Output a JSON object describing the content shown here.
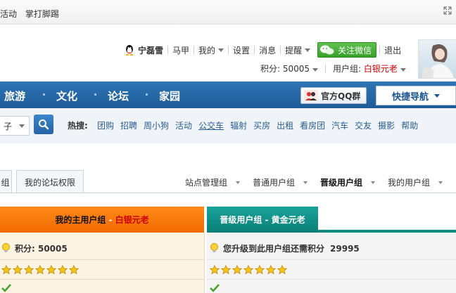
{
  "topbar": {
    "links": [
      "活动",
      "掌打脚踢"
    ]
  },
  "user": {
    "name": "宁磊雪",
    "menu": [
      "马甲",
      "我的",
      "设置",
      "消息",
      "提醒"
    ],
    "wechat_label": "关注微信",
    "logout": "退出",
    "score_label": "积分: 50005",
    "group_prefix": "用户组: ",
    "group_name": "白银元老"
  },
  "nav": {
    "items": [
      "旅游",
      "文化",
      "论坛",
      "家园"
    ],
    "qq_group": "官方QQ群",
    "quick_nav": "快捷导航"
  },
  "search": {
    "select_value": "子",
    "hot_label": "热搜:",
    "hot_links": [
      "团购",
      "招聘",
      "周小狗",
      "活动",
      "公交车",
      "辐射",
      "买房",
      "出租",
      "看房团",
      "汽车",
      "交友",
      "摄影",
      "帮助"
    ]
  },
  "tabs": {
    "left": [
      "组",
      "我的论坛权限"
    ],
    "right": [
      "站点管理组",
      "普通用户组",
      "晋级用户组",
      "我的用户组"
    ]
  },
  "panels": {
    "left_title_prefix": "我的主用户组",
    "left_title_sep": " - ",
    "left_title_group": "白银元老",
    "right_title": "晋级用户组 - 黄金元老",
    "left_score": "积分: 50005",
    "right_upgrade": "您升级到此用户组还需积分",
    "right_upgrade_value": "29995",
    "left_stars": 7,
    "right_stars": 7
  },
  "colors": {
    "accent_blue": "#1e5c98",
    "orange": "#f26a00",
    "teal": "#0b7f76",
    "red_text": "#cc0000"
  }
}
